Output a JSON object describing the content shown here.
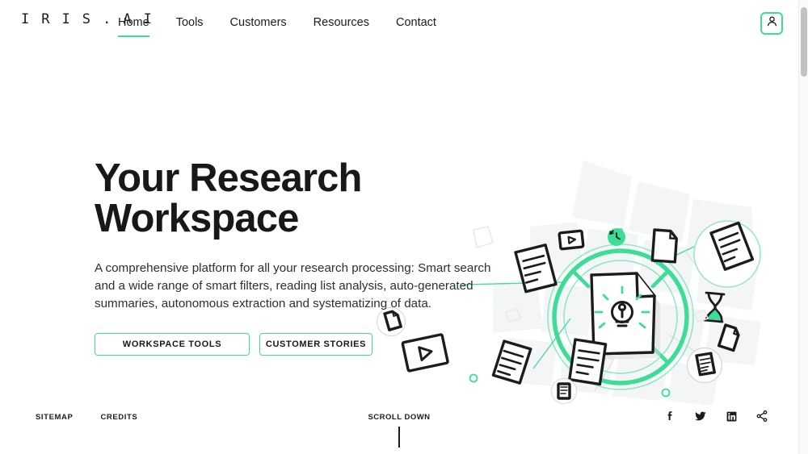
{
  "brand": {
    "logo_text": "I R I S . A I",
    "accent_color": "#3ddc97",
    "text_color": "#1c1c1c"
  },
  "nav": {
    "items": [
      {
        "label": "Home",
        "active": true
      },
      {
        "label": "Tools",
        "active": false
      },
      {
        "label": "Customers",
        "active": false
      },
      {
        "label": "Resources",
        "active": false
      },
      {
        "label": "Contact",
        "active": false
      }
    ],
    "account_icon": "user-account-icon"
  },
  "hero": {
    "title": "Your Research\nWorkspace",
    "subtitle": "A comprehensive platform for all your research processing: Smart search and a wide range of smart filters, reading list analysis, auto-generated summaries, autonomous extraction and systematizing of data.",
    "buttons": [
      {
        "label": "WORKSPACE TOOLS"
      },
      {
        "label": "CUSTOMER STORIES"
      }
    ]
  },
  "illustration": {
    "center_icon": "document-lightbulb-icon",
    "ring_color": "#3ddc97",
    "satellite_icons": [
      "document-lines-icon",
      "video-play-icon",
      "blank-page-icon",
      "document-circle-icon",
      "hourglass-icon",
      "clock-icon",
      "folded-page-icon",
      "note-icon"
    ]
  },
  "footer": {
    "links": [
      {
        "label": "SITEMAP"
      },
      {
        "label": "CREDITS"
      }
    ],
    "scroll_label": "SCROLL DOWN",
    "socials": [
      {
        "name": "facebook-icon"
      },
      {
        "name": "twitter-icon"
      },
      {
        "name": "linkedin-icon"
      },
      {
        "name": "share-icon"
      }
    ]
  },
  "scrollbar": {
    "position": "top"
  }
}
